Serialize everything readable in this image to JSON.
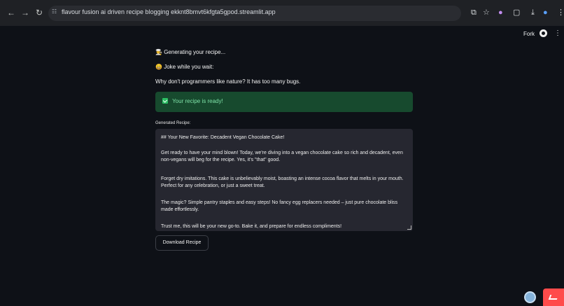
{
  "browser": {
    "url": "flavour fusion ai driven recipe blogging ekknt8bmvt6kfgta5gpod.streamlit.app",
    "nav": {
      "back": "←",
      "forward": "→",
      "reload": "↻"
    },
    "tune_icon": "tune-icon",
    "right_icons": [
      "⧉",
      "☆",
      "●",
      "▢",
      "⤓",
      "●",
      "⋮"
    ]
  },
  "app_header": {
    "fork_label": "Fork",
    "github_icon": "github-icon",
    "menu_icon": "⋮"
  },
  "main": {
    "generating_text": "Generating your recipe...",
    "joke_prompt": "Joke while you wait:",
    "joke_text": "Why don't programmers like nature? It has too many bugs.",
    "success_text": "Your recipe is ready!",
    "generated_label": "Generated Recipe:",
    "recipe_lines": [
      "## Your New Favorite: Decadent Vegan Chocolate Cake!",
      "Get ready to have your mind blown! Today, we're diving into a vegan chocolate cake so rich and decadent, even non-vegans will beg for the recipe. Yes, it's \"that\" good.",
      "Forget dry imitations. This cake is unbelievably moist, boasting an intense cocoa flavor that melts in your mouth. Perfect for any celebration, or just a sweet treat.",
      "The magic? Simple pantry staples and easy steps! No fancy egg replacers needed – just pure chocolate bliss made effortlessly.",
      "Trust me, this will be your new go-to. Bake it, and prepare for endless compliments!"
    ],
    "download_label": "Download Recipe"
  },
  "colors": {
    "background": "#0e1117",
    "success_bg": "#174a2e",
    "success_text": "#7ee2a8",
    "textarea_bg": "#262730",
    "badge_red": "#ff4b4b"
  }
}
